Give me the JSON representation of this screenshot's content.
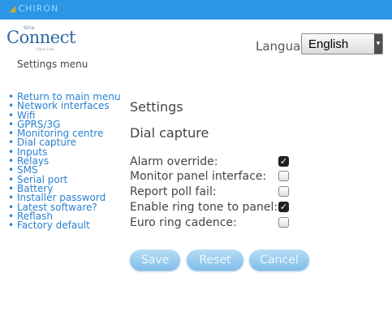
{
  "brand": {
    "name": "CHIRON"
  },
  "logo": {
    "small_text": "Siria",
    "main_text": "Connect",
    "tagline": "Alarm Link"
  },
  "language": {
    "label": "Language:",
    "value": "English"
  },
  "sidebar": {
    "title": "Settings menu",
    "items": [
      {
        "label": "Return to main menu"
      },
      {
        "label": "Network interfaces"
      },
      {
        "label": "Wifi"
      },
      {
        "label": "GPRS/3G"
      },
      {
        "label": "Monitoring centre"
      },
      {
        "label": "Dial capture"
      },
      {
        "label": "Inputs"
      },
      {
        "label": "Relays"
      },
      {
        "label": "SMS"
      },
      {
        "label": "Serial port"
      },
      {
        "label": "Battery"
      },
      {
        "label": "Installer password"
      },
      {
        "label": "Latest software?"
      },
      {
        "label": "Reflash"
      },
      {
        "label": "Factory default"
      }
    ]
  },
  "main": {
    "heading": "Settings",
    "section": "Dial capture",
    "options": [
      {
        "label": "Alarm override:",
        "checked": true
      },
      {
        "label": "Monitor panel interface:",
        "checked": false
      },
      {
        "label": "Report poll fail:",
        "checked": false
      },
      {
        "label": "Enable ring tone to panel:",
        "checked": true
      },
      {
        "label": "Euro ring cadence:",
        "checked": false
      }
    ],
    "buttons": {
      "save": "Save",
      "reset": "Reset",
      "cancel": "Cancel"
    }
  },
  "colors": {
    "topbar": "#2a96e5",
    "link": "#2b82d2",
    "button": "#9ccfef"
  }
}
